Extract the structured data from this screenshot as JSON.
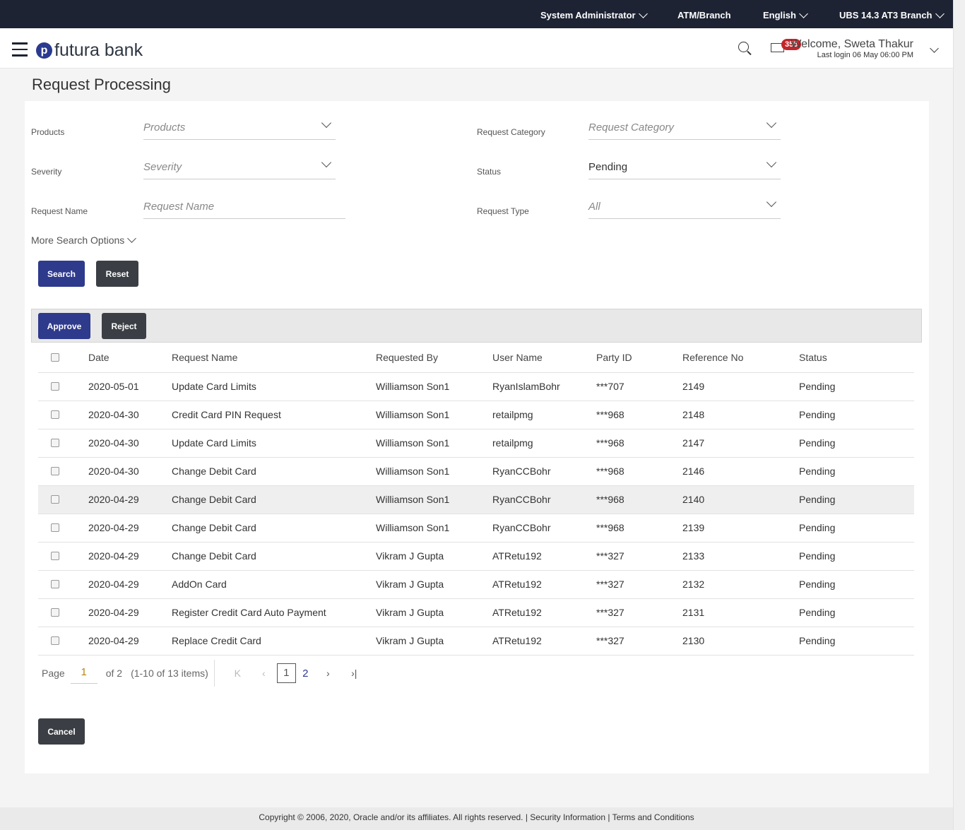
{
  "topbar": {
    "role": "System Administrator",
    "atm": "ATM/Branch",
    "language": "English",
    "branch": "UBS 14.3 AT3 Branch"
  },
  "header": {
    "brand": "futura bank",
    "logo_mark": "p",
    "notifications": "355",
    "welcome": "Welcome, Sweta Thakur",
    "last_login": "Last login 06 May 06:00 PM"
  },
  "page_title": "Request Processing",
  "filters": {
    "products_label": "Products",
    "products_placeholder": "Products",
    "category_label": "Request Category",
    "category_placeholder": "Request Category",
    "severity_label": "Severity",
    "severity_placeholder": "Severity",
    "status_label": "Status",
    "status_value": "Pending",
    "name_label": "Request Name",
    "name_placeholder": "Request Name",
    "type_label": "Request Type",
    "type_value": "All",
    "more": "More Search Options"
  },
  "buttons": {
    "search": "Search",
    "reset": "Reset",
    "approve": "Approve",
    "reject": "Reject",
    "cancel": "Cancel"
  },
  "table": {
    "headers": [
      "Date",
      "Request Name",
      "Requested By",
      "User Name",
      "Party ID",
      "Reference No",
      "Status"
    ],
    "rows": [
      [
        "2020-05-01",
        "Update Card Limits",
        "Williamson Son1",
        "RyanIslamBohr",
        "***707",
        "2149",
        "Pending"
      ],
      [
        "2020-04-30",
        "Credit Card PIN Request",
        "Williamson Son1",
        "retailpmg",
        "***968",
        "2148",
        "Pending"
      ],
      [
        "2020-04-30",
        "Update Card Limits",
        "Williamson Son1",
        "retailpmg",
        "***968",
        "2147",
        "Pending"
      ],
      [
        "2020-04-30",
        "Change Debit Card",
        "Williamson Son1",
        "RyanCCBohr",
        "***968",
        "2146",
        "Pending"
      ],
      [
        "2020-04-29",
        "Change Debit Card",
        "Williamson Son1",
        "RyanCCBohr",
        "***968",
        "2140",
        "Pending"
      ],
      [
        "2020-04-29",
        "Change Debit Card",
        "Williamson Son1",
        "RyanCCBohr",
        "***968",
        "2139",
        "Pending"
      ],
      [
        "2020-04-29",
        "Change Debit Card",
        "Vikram J Gupta",
        "ATRetu192",
        "***327",
        "2133",
        "Pending"
      ],
      [
        "2020-04-29",
        "AddOn Card",
        "Vikram J Gupta",
        "ATRetu192",
        "***327",
        "2132",
        "Pending"
      ],
      [
        "2020-04-29",
        "Register Credit Card Auto Payment",
        "Vikram J Gupta",
        "ATRetu192",
        "***327",
        "2131",
        "Pending"
      ],
      [
        "2020-04-29",
        "Replace Credit Card",
        "Vikram J Gupta",
        "ATRetu192",
        "***327",
        "2130",
        "Pending"
      ]
    ]
  },
  "pager": {
    "page_label": "Page",
    "page": "1",
    "of": "of 2",
    "items": "(1-10 of 13 items)",
    "pages": [
      "1",
      "2"
    ]
  },
  "footer": "Copyright © 2006, 2020, Oracle and/or its affiliates. All rights reserved. | Security Information | Terms and Conditions"
}
